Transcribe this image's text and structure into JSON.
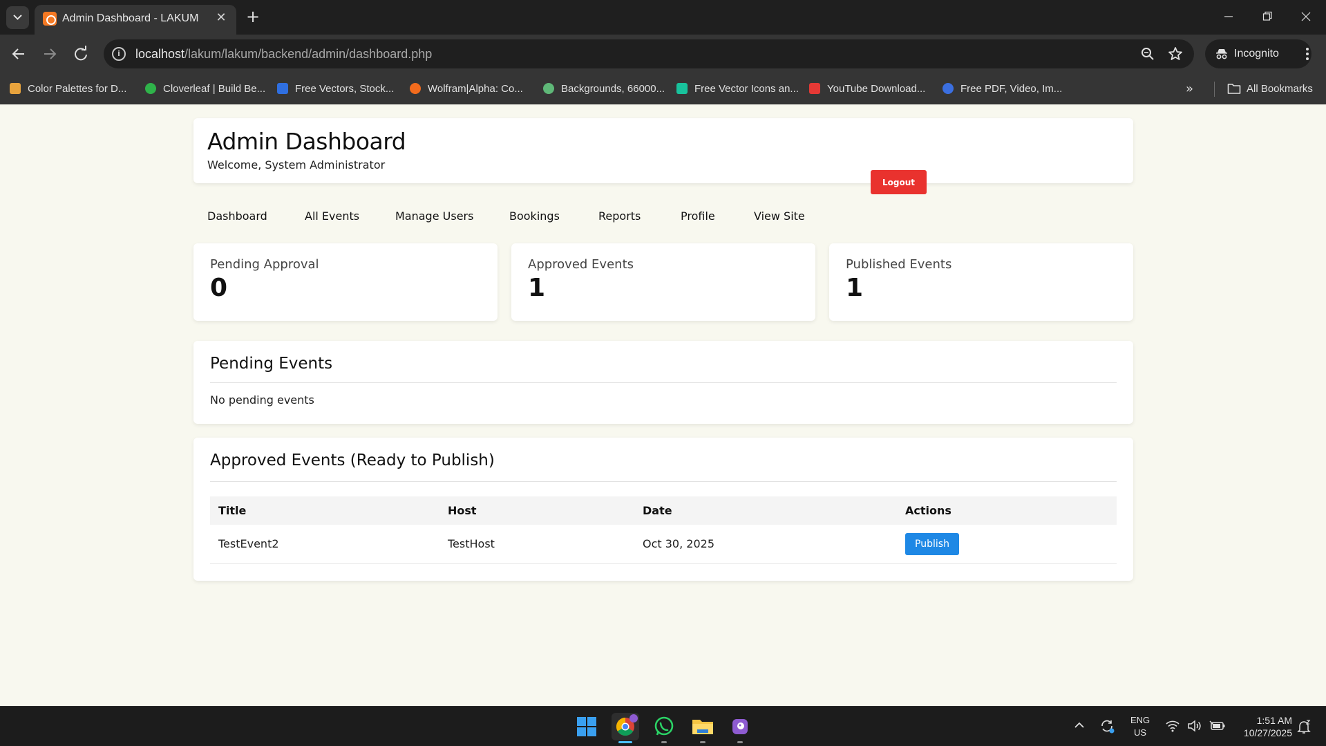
{
  "browser": {
    "tab_title": "Admin Dashboard - LAKUM",
    "url_host": "localhost",
    "url_path": "/lakum/lakum/backend/admin/dashboard.php",
    "incognito_label": "Incognito",
    "bookmarks": [
      {
        "label": "Color Palettes for D...",
        "color": "#e8a33d"
      },
      {
        "label": "Cloverleaf | Build Be...",
        "color": "#2fb34a"
      },
      {
        "label": "Free Vectors, Stock...",
        "color": "#2f6fe0"
      },
      {
        "label": "Wolfram|Alpha: Co...",
        "color": "#f26b1d"
      },
      {
        "label": "Backgrounds, 66000...",
        "color": "#5fb878"
      },
      {
        "label": "Free Vector Icons an...",
        "color": "#18c29c"
      },
      {
        "label": "YouTube Download...",
        "color": "#e53935"
      },
      {
        "label": "Free PDF, Video, Im...",
        "color": "#3b6fe0"
      }
    ],
    "all_bookmarks_label": "All Bookmarks"
  },
  "header": {
    "title": "Admin Dashboard",
    "welcome": "Welcome, System Administrator",
    "logout_label": "Logout"
  },
  "nav": {
    "items": [
      "Dashboard",
      "All Events",
      "Manage Users",
      "Bookings",
      "Reports",
      "Profile",
      "View Site"
    ]
  },
  "stats": [
    {
      "label": "Pending Approval",
      "value": "0"
    },
    {
      "label": "Approved Events",
      "value": "1"
    },
    {
      "label": "Published Events",
      "value": "1"
    }
  ],
  "pending_section": {
    "title": "Pending Events",
    "empty_text": "No pending events"
  },
  "approved_section": {
    "title": "Approved Events (Ready to Publish)",
    "columns": [
      "Title",
      "Host",
      "Date",
      "Actions"
    ],
    "rows": [
      {
        "title": "TestEvent2",
        "host": "TestHost",
        "date": "Oct 30, 2025",
        "action": "Publish"
      }
    ]
  },
  "taskbar": {
    "lang_line1": "ENG",
    "lang_line2": "US",
    "time": "1:51 AM",
    "date": "10/27/2025",
    "apps": [
      "windows-start",
      "chrome",
      "whatsapp",
      "file-explorer",
      "notes-app"
    ]
  },
  "colors": {
    "page_bg": "#f8f8ef",
    "logout": "#e9322e",
    "publish": "#1e88e5"
  }
}
